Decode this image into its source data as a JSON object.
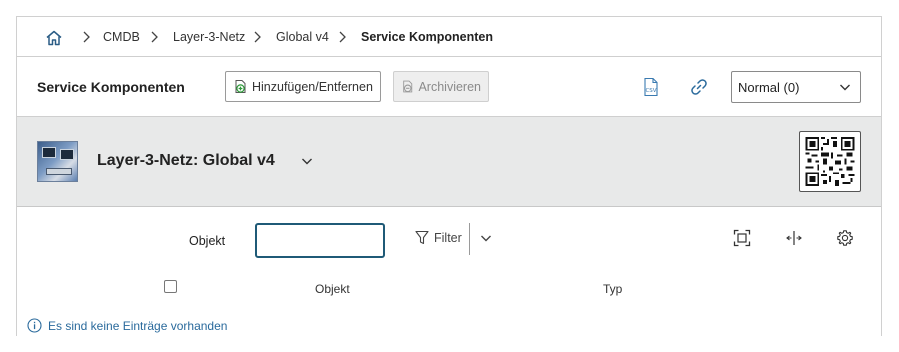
{
  "breadcrumb": {
    "home_icon": "home-icon",
    "items": [
      {
        "label": "CMDB"
      },
      {
        "label": "Layer-3-Netz"
      },
      {
        "label": "Global v4"
      },
      {
        "label": "Service Komponenten"
      }
    ]
  },
  "toolbar": {
    "title": "Service Komponenten",
    "add_remove_label": "Hinzufügen/Entfernen",
    "archive_label": "Archivieren",
    "csv_icon": "csv-export-icon",
    "link_icon": "link-icon",
    "view_select": {
      "value": "Normal (0)"
    }
  },
  "object": {
    "title": "Layer-3-Netz: Global v4",
    "image_icon": "network-object-image",
    "qr_icon": "qr-code-icon"
  },
  "list": {
    "filter_label": "Objekt",
    "search_value": "",
    "filter_button_label": "Filter",
    "columns": [
      "Objekt",
      "Typ"
    ],
    "rows": [],
    "empty_message": "Es sind keine Einträge vorhanden"
  },
  "colors": {
    "accent": "#1f5a77",
    "link": "#2a6a9c",
    "header_bg": "#e8e9e9",
    "csv_icon": "#3a7ab0"
  }
}
